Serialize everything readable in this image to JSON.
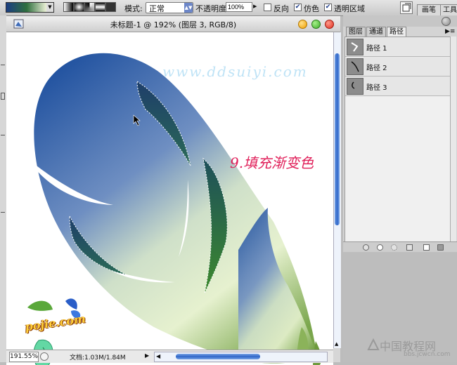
{
  "options_bar": {
    "mode_label": "模式:",
    "mode_value": "正常",
    "opacity_label": "不透明度:",
    "opacity_value": "100%",
    "reverse_label": "反向",
    "dither_label": "仿色",
    "transparency_label": "透明区域",
    "reverse_checked": false,
    "dither_checked": true,
    "transparency_checked": true,
    "gradient_preview": "gradient-swatch",
    "right_tabs": [
      "画笔",
      "工具"
    ]
  },
  "document": {
    "title": "未标题-1 @ 192% (图层 3, RGB/8)",
    "watermark": "www.ddsuiyi.com",
    "step_label": "9.填充渐变色",
    "zoom": "191.55%",
    "doc_info": "文档:1.03M/1.84M",
    "logo_text": "pojie.com"
  },
  "panel": {
    "tabs": [
      "图层",
      "通道",
      "路径"
    ],
    "active_tab": "路径",
    "paths": [
      {
        "name": "路径 1",
        "icon": "pen-path-icon"
      },
      {
        "name": "路径 2",
        "icon": "curve-path-icon"
      },
      {
        "name": "路径 3",
        "icon": "hook-path-icon"
      }
    ],
    "footer_icons": [
      "fill-path-icon",
      "stroke-path-icon",
      "load-selection-icon",
      "make-path-icon",
      "new-path-icon",
      "delete-path-icon"
    ]
  },
  "footer_site": {
    "name": "中国教程网",
    "url": "bbs.jcwcn.com"
  },
  "colors": {
    "feather_top": "#1d4f9e",
    "feather_bottom": "#e6f1cf",
    "step_label": "#e0205a",
    "scroll_thumb": "#2e66c8"
  }
}
